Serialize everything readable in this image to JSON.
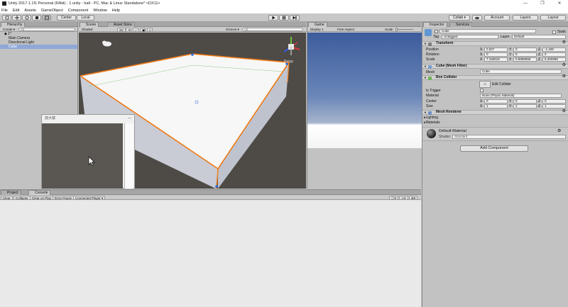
{
  "window": {
    "title": "Unity 2017.1.1f1 Personal (64bit) - 1.unity - ball - PC, Mac & Linux Standalone* <DX11>",
    "controls": [
      "—",
      "❐",
      "✕"
    ]
  },
  "menu": [
    "File",
    "Edit",
    "Assets",
    "GameObject",
    "Component",
    "Window",
    "Help"
  ],
  "toolbar": {
    "pivot": "Center",
    "space": "Local",
    "collab": "Collab ▾",
    "account": "Account",
    "layers": "Layers",
    "layout": "Layout"
  },
  "hierarchy": {
    "tab": "Hierarchy",
    "create": "Create ▾",
    "search_placeholder": "All",
    "scene": "1*",
    "items": [
      "Main Camera",
      "Directional Light",
      "Cube"
    ]
  },
  "scene": {
    "tabs": [
      "Scene",
      "Asset Store"
    ],
    "shading": "Shaded",
    "mode2d": "2D",
    "gizmos": "Gizmos ▾",
    "search_placeholder": "All",
    "persp": "Persp"
  },
  "game": {
    "tab": "Game",
    "display": "Display 1",
    "aspect": "Free Aspect",
    "scale_label": "Scale"
  },
  "magnifier": {
    "title": "放大镜",
    "close": "—"
  },
  "console": {
    "tabs": [
      "Project",
      "Console"
    ],
    "buttons": [
      "Clear",
      "Collapse",
      "Clear on Play",
      "Error Pause",
      "Connected Player ▾"
    ],
    "counts": [
      "0",
      "0",
      "0"
    ]
  },
  "inspector": {
    "tabs": [
      "Inspector",
      "Services"
    ],
    "object_name": "Cube",
    "static_label": "Static",
    "tag_label": "Tag",
    "tag_value": "Untagged",
    "layer_label": "Layer",
    "layer_value": "Default",
    "transform": {
      "title": "Transform",
      "position": {
        "label": "Position",
        "x": "0.027",
        "y": "0",
        "z": "-1.429"
      },
      "rotation": {
        "label": "Rotation",
        "x": "0",
        "y": "0",
        "z": "0"
      },
      "scale": {
        "label": "Scale",
        "x": "7.166918",
        "y": "0.9999996",
        "z": "6.300999"
      }
    },
    "mesh_filter": {
      "title": "Cube (Mesh Filter)",
      "mesh_label": "Mesh",
      "mesh_value": "Cube"
    },
    "box_collider": {
      "title": "Box Collider",
      "edit_label": "Edit Collider",
      "trigger_label": "Is Trigger",
      "material_label": "Material",
      "material_value": "None (Physic Material)",
      "center": {
        "label": "Center",
        "x": "0",
        "y": "0",
        "z": "0"
      },
      "size": {
        "label": "Size",
        "x": "1",
        "y": "1",
        "z": "1"
      }
    },
    "mesh_renderer": {
      "title": "Mesh Renderer",
      "lighting": "Lighting",
      "materials": "Materials"
    },
    "material": {
      "name": "Default-Material",
      "shader_label": "Shader",
      "shader_value": "Standard"
    },
    "add_component": "Add Component"
  },
  "colors": {
    "scene_bg": "#4e4b47",
    "selection": "#f07a16",
    "sky_top": "#3c5c9c",
    "header": "#a6a6a6"
  }
}
